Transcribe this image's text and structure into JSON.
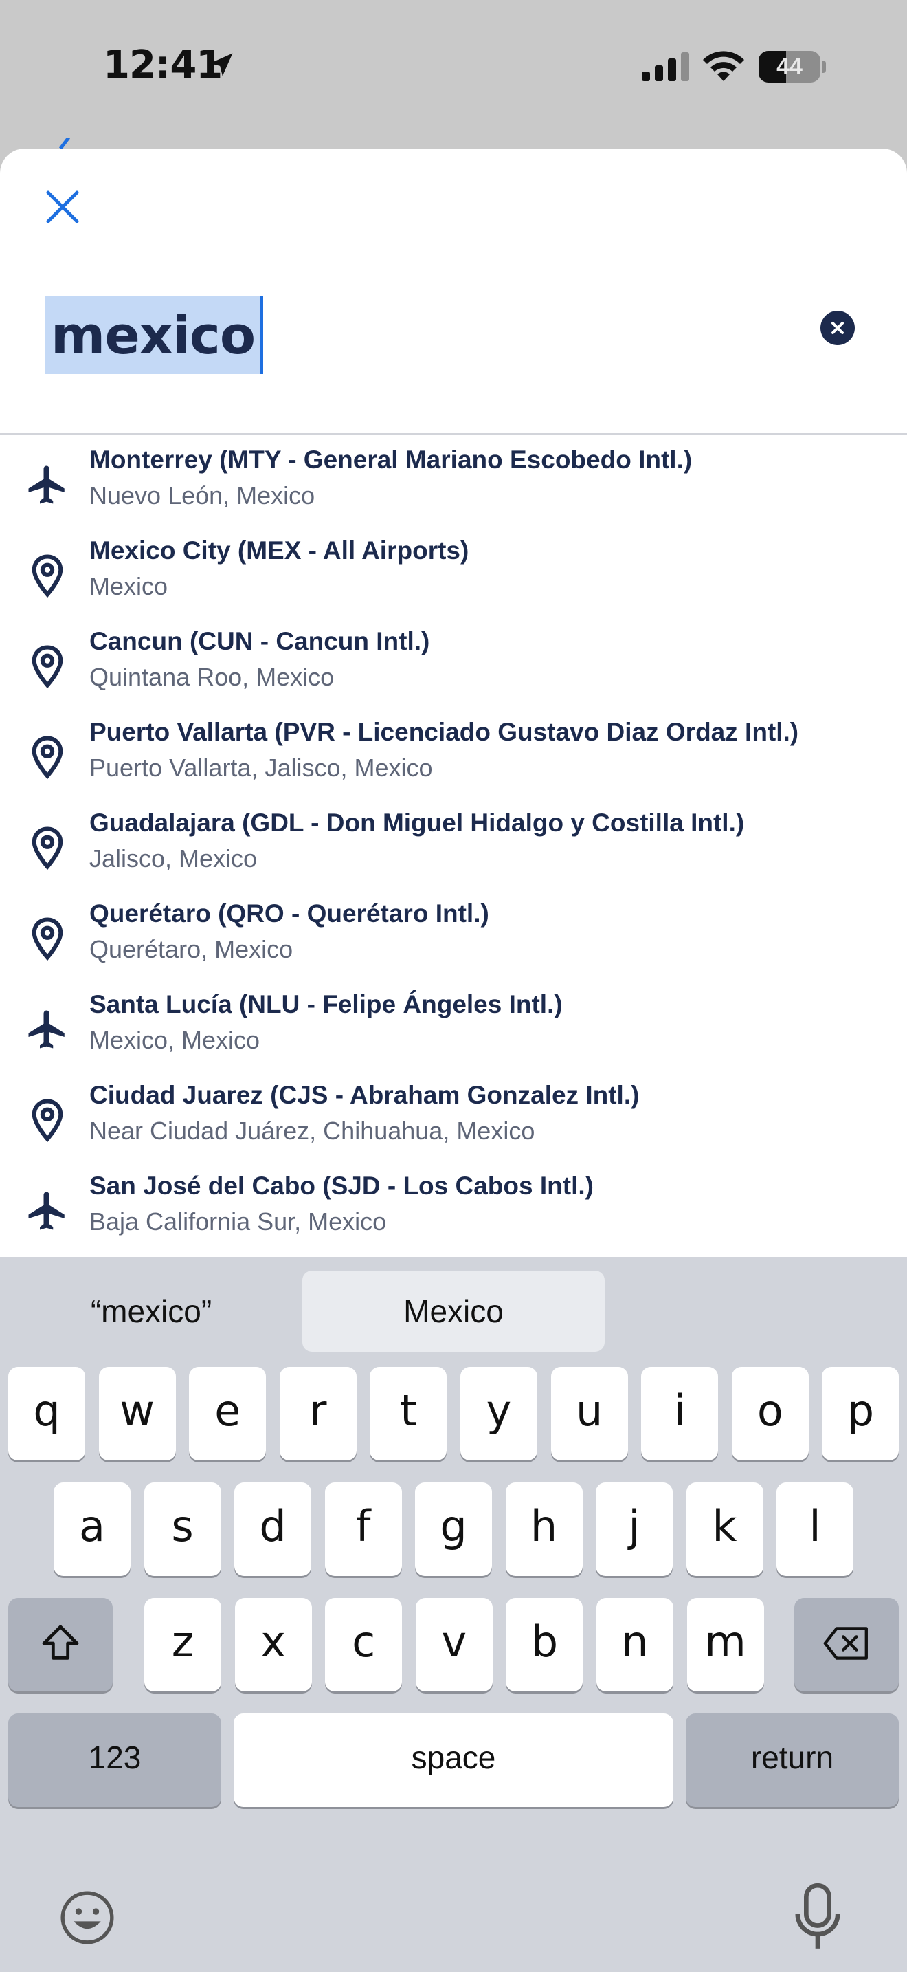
{
  "status_bar": {
    "time": "12:41",
    "battery_percent": "44",
    "battery_level": 0.44,
    "icons": [
      "location-arrow-icon",
      "signal-icon",
      "wifi-icon",
      "battery-icon"
    ]
  },
  "colors": {
    "accent": "#1e6fe0",
    "navy": "#1c2a4d",
    "subtitle": "#5f6678",
    "selection": "#c4d9f6"
  },
  "search": {
    "value": "mexico"
  },
  "results": [
    {
      "icon": "airplane-icon",
      "title": "Monterrey (MTY - General Mariano Escobedo Intl.)",
      "subtitle": "Nuevo León, Mexico"
    },
    {
      "icon": "location-pin-icon",
      "title": "Mexico City (MEX - All Airports)",
      "subtitle": "Mexico"
    },
    {
      "icon": "location-pin-icon",
      "title": "Cancun (CUN - Cancun Intl.)",
      "subtitle": "Quintana Roo, Mexico"
    },
    {
      "icon": "location-pin-icon",
      "title": "Puerto Vallarta (PVR - Licenciado Gustavo Diaz Ordaz Intl.)",
      "subtitle": "Puerto Vallarta, Jalisco, Mexico"
    },
    {
      "icon": "location-pin-icon",
      "title": "Guadalajara (GDL - Don Miguel Hidalgo y Costilla Intl.)",
      "subtitle": "Jalisco, Mexico"
    },
    {
      "icon": "location-pin-icon",
      "title": "Querétaro (QRO - Querétaro Intl.)",
      "subtitle": "Querétaro, Mexico"
    },
    {
      "icon": "airplane-icon",
      "title": "Santa Lucía (NLU - Felipe Ángeles Intl.)",
      "subtitle": "Mexico, Mexico"
    },
    {
      "icon": "location-pin-icon",
      "title": "Ciudad Juarez (CJS - Abraham Gonzalez Intl.)",
      "subtitle": "Near Ciudad Juárez, Chihuahua, Mexico"
    },
    {
      "icon": "airplane-icon",
      "title": "San José del Cabo (SJD - Los Cabos Intl.)",
      "subtitle": "Baja California Sur, Mexico"
    }
  ],
  "keyboard": {
    "suggestions": [
      "“mexico”",
      "Mexico"
    ],
    "row1": [
      "q",
      "w",
      "e",
      "r",
      "t",
      "y",
      "u",
      "i",
      "o",
      "p"
    ],
    "row2": [
      "a",
      "s",
      "d",
      "f",
      "g",
      "h",
      "j",
      "k",
      "l"
    ],
    "row3": [
      "z",
      "x",
      "c",
      "v",
      "b",
      "n",
      "m"
    ],
    "numbers_key": "123",
    "space_key": "space",
    "return_key": "return"
  }
}
